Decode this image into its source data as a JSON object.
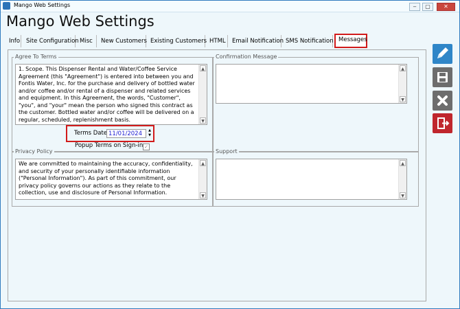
{
  "window": {
    "title": "Mango Web Settings",
    "minimize": "‒",
    "maximize": "▢",
    "close": "✕"
  },
  "app_title": "Mango Web Settings",
  "tabs": [
    {
      "label": "Info",
      "active": false
    },
    {
      "label": "Site Configuration",
      "active": false
    },
    {
      "label": "Misc",
      "active": false
    },
    {
      "label": "New Customers",
      "active": false
    },
    {
      "label": "Existing Customers",
      "active": false
    },
    {
      "label": "HTML",
      "active": false
    },
    {
      "label": "Email Notification",
      "active": false
    },
    {
      "label": "SMS Notification",
      "active": false
    },
    {
      "label": "Messages",
      "active": true
    }
  ],
  "agree_terms": {
    "label": "Agree To Terms",
    "text": "1. Scope.  This Dispenser Rental and Water/Coffee Service Agreement (this \"Agreement\") is entered into between you and Fontis Water, Inc. for the purchase and delivery of bottled water and/or coffee and/or rental of a dispenser and related services and equipment.  In this Agreement, the words, \"Customer\", \"you\", and \"your\" mean the person who signed this contract as the customer. Bottled water and/or coffee will be delivered on a regular, scheduled, replenishment basis.",
    "terms_date_label": "Terms Date",
    "terms_date_value": "11/01/2024",
    "popup_label": "Popup Terms on Sign-in",
    "popup_checked": true
  },
  "confirmation": {
    "label": "Confirmation Message",
    "text": ""
  },
  "privacy": {
    "label": "Privacy Policy",
    "text": "We are committed to maintaining the accuracy, confidentiality, and security of your personally identifiable information (\"Personal Information\"). As part of this commitment, our privacy policy governs our actions as they relate to the collection, use and disclosure of Personal Information."
  },
  "support": {
    "label": "Support",
    "text": ""
  },
  "sidebar": [
    {
      "icon": "pencil-icon",
      "color": "#2f86c8"
    },
    {
      "icon": "save-icon",
      "color": "#6d6d6d"
    },
    {
      "icon": "close-icon",
      "color": "#6d6d6d"
    },
    {
      "icon": "exit-icon",
      "color": "#c0262d"
    }
  ]
}
